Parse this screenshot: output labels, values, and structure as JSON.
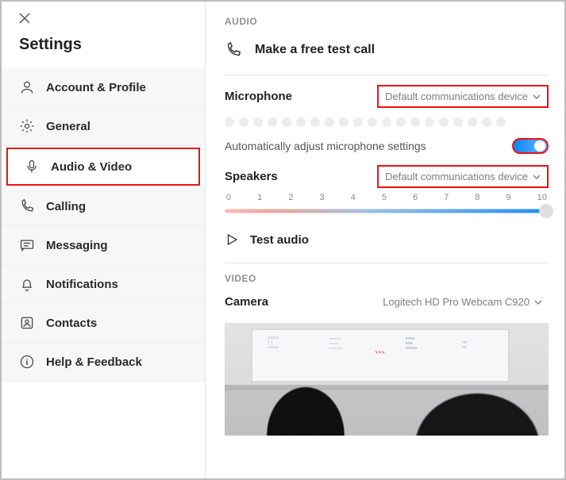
{
  "header": {
    "title": "Settings"
  },
  "sidebar": {
    "items": [
      {
        "label": "Account & Profile"
      },
      {
        "label": "General"
      },
      {
        "label": "Audio & Video"
      },
      {
        "label": "Calling"
      },
      {
        "label": "Messaging"
      },
      {
        "label": "Notifications"
      },
      {
        "label": "Contacts"
      },
      {
        "label": "Help & Feedback"
      }
    ],
    "active_index": 2
  },
  "audio": {
    "section_label": "AUDIO",
    "test_call_label": "Make a free test call",
    "microphone": {
      "label": "Microphone",
      "selected": "Default communications device",
      "level_dots": 20
    },
    "auto_adjust": {
      "label": "Automatically adjust microphone settings",
      "value": true
    },
    "speakers": {
      "label": "Speakers",
      "selected": "Default communications device",
      "ticks": [
        "0",
        "1",
        "2",
        "3",
        "4",
        "5",
        "6",
        "7",
        "8",
        "9",
        "10"
      ],
      "value": 10
    },
    "test_audio_label": "Test audio"
  },
  "video": {
    "section_label": "VIDEO",
    "camera": {
      "label": "Camera",
      "selected": "Logitech HD Pro Webcam C920"
    }
  }
}
